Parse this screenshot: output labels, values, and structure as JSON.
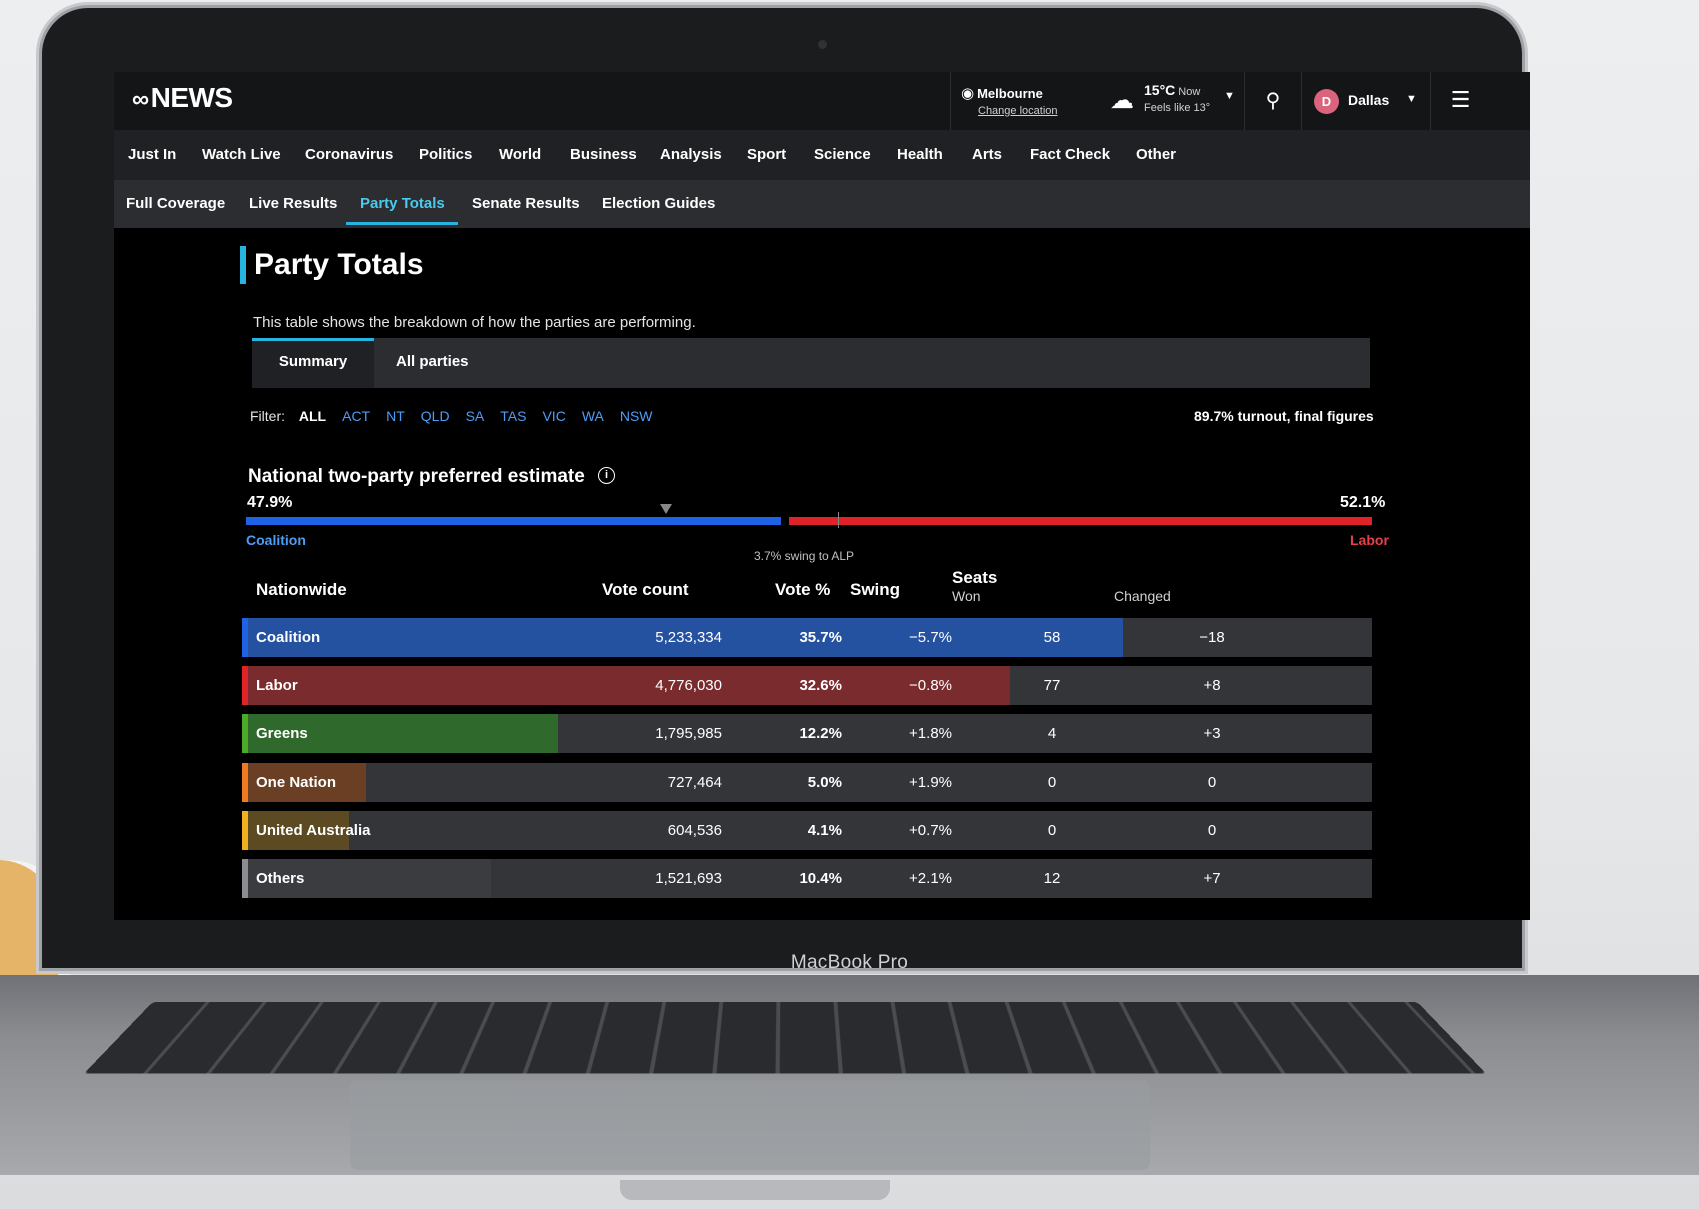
{
  "header": {
    "logo": "NEWS",
    "location": {
      "city": "Melbourne",
      "change_label": "Change location"
    },
    "weather": {
      "temp": "15°C",
      "now_label": "Now",
      "feels": "Feels like 13°"
    },
    "user": {
      "initial": "D",
      "name": "Dallas"
    }
  },
  "nav_primary": [
    "Just In",
    "Watch Live",
    "Coronavirus",
    "Politics",
    "World",
    "Business",
    "Analysis",
    "Sport",
    "Science",
    "Health",
    "Arts",
    "Fact Check",
    "Other"
  ],
  "nav_secondary": {
    "items": [
      "Full Coverage",
      "Live Results",
      "Party Totals",
      "Senate Results",
      "Election Guides"
    ],
    "active": "Party Totals"
  },
  "page": {
    "title": "Party Totals",
    "description": "This table shows the breakdown of how the parties are performing.",
    "tabs": [
      "Summary",
      "All parties"
    ],
    "filter_label": "Filter:",
    "filters": [
      "ALL",
      "ACT",
      "NT",
      "QLD",
      "SA",
      "TAS",
      "VIC",
      "WA",
      "NSW"
    ],
    "filter_selected": "ALL",
    "turnout": "89.7% turnout, final figures"
  },
  "tpp": {
    "title": "National two-party preferred estimate",
    "left_pct_label": "47.9%",
    "right_pct_label": "52.1%",
    "left_value": 47.9,
    "right_value": 52.1,
    "left_party": "Coalition",
    "right_party": "Labor",
    "swing_note": "3.7% swing to ALP",
    "colors": {
      "left": "#1e63e6",
      "right": "#e02229"
    }
  },
  "table": {
    "headers": {
      "name": "Nationwide",
      "votes": "Vote count",
      "pct": "Vote %",
      "swing": "Swing",
      "seats": "Seats",
      "won": "Won",
      "changed": "Changed"
    },
    "rows": [
      {
        "party": "Coalition",
        "votes": "5,233,334",
        "pct": "35.7%",
        "swing": "−5.7%",
        "won": "58",
        "changed": "−18",
        "seat_share": 0.78,
        "color": "#2452a0",
        "edge": "#1e63e6"
      },
      {
        "party": "Labor",
        "votes": "4,776,030",
        "pct": "32.6%",
        "swing": "−0.8%",
        "won": "77",
        "changed": "+8",
        "seat_share": 0.68,
        "color": "#7a2b2e",
        "edge": "#e02229"
      },
      {
        "party": "Greens",
        "votes": "1,795,985",
        "pct": "12.2%",
        "swing": "+1.8%",
        "won": "4",
        "changed": "+3",
        "seat_share": 0.28,
        "color": "#2f6a2c",
        "edge": "#4caa2a"
      },
      {
        "party": "One Nation",
        "votes": "727,464",
        "pct": "5.0%",
        "swing": "+1.9%",
        "won": "0",
        "changed": "0",
        "seat_share": 0.11,
        "color": "#6a3f23",
        "edge": "#f07a20"
      },
      {
        "party": "United Australia",
        "votes": "604,536",
        "pct": "4.1%",
        "swing": "+0.7%",
        "won": "0",
        "changed": "0",
        "seat_share": 0.095,
        "color": "#5c4a22",
        "edge": "#f2b01e"
      },
      {
        "party": "Others",
        "votes": "1,521,693",
        "pct": "10.4%",
        "swing": "+2.1%",
        "won": "12",
        "changed": "+7",
        "seat_share": 0.22,
        "color": "#3a3c40",
        "edge": "#8a8c90"
      }
    ]
  },
  "device": {
    "label": "MacBook Pro"
  }
}
